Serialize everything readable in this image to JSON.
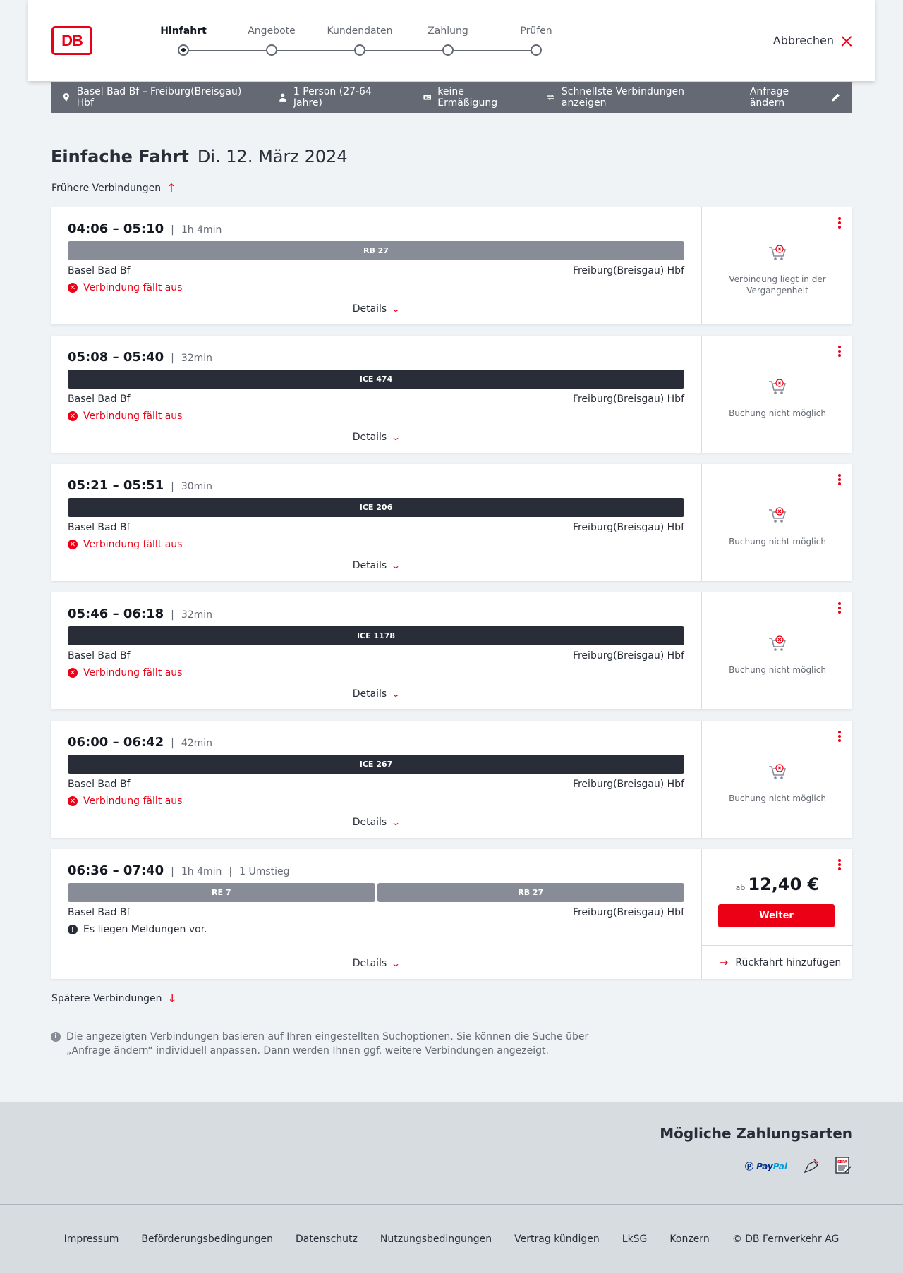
{
  "brand": {
    "logo_text": "DB",
    "accent": "#ec0016"
  },
  "steps": [
    {
      "label": "Hinfahrt",
      "active": true
    },
    {
      "label": "Angebote",
      "active": false
    },
    {
      "label": "Kundendaten",
      "active": false
    },
    {
      "label": "Zahlung",
      "active": false
    },
    {
      "label": "Prüfen",
      "active": false
    }
  ],
  "header": {
    "cancel_label": "Abbrechen"
  },
  "search": {
    "route": "Basel Bad Bf – Freiburg(Breisgau) Hbf",
    "travellers": "1 Person (27-64 Jahre)",
    "discount": "keine Ermäßigung",
    "fastest": "Schnellste Verbindungen anzeigen",
    "edit_label": "Anfrage ändern"
  },
  "page": {
    "title_bold": "Einfache Fahrt",
    "title_date": "Di. 12. März 2024",
    "earlier_label": "Frühere Verbindungen",
    "later_label": "Spätere Verbindungen",
    "details_label": "Details",
    "info_text": "Die angezeigten Verbindungen basieren auf Ihren eingestellten Suchoptionen. Sie können die Suche über „Anfrage ändern“ individuell anpassen. Dann werden Ihnen ggf. weitere Verbindungen angezeigt."
  },
  "connections": [
    {
      "times": "04:06 – 05:10",
      "duration": "1h 4min",
      "transfers": "",
      "trains": [
        {
          "name": "RB 27",
          "style": "grey"
        }
      ],
      "from": "Basel Bad Bf",
      "to": "Freiburg(Breisgau) Hbf",
      "status": "Verbindung fällt aus",
      "status_type": "cancelled",
      "side": "Verbindung liegt in der Vergangenheit"
    },
    {
      "times": "05:08 – 05:40",
      "duration": "32min",
      "transfers": "",
      "trains": [
        {
          "name": "ICE 474",
          "style": "dark"
        }
      ],
      "from": "Basel Bad Bf",
      "to": "Freiburg(Breisgau) Hbf",
      "status": "Verbindung fällt aus",
      "status_type": "cancelled",
      "side": "Buchung nicht möglich"
    },
    {
      "times": "05:21 – 05:51",
      "duration": "30min",
      "transfers": "",
      "trains": [
        {
          "name": "ICE 206",
          "style": "dark"
        }
      ],
      "from": "Basel Bad Bf",
      "to": "Freiburg(Breisgau) Hbf",
      "status": "Verbindung fällt aus",
      "status_type": "cancelled",
      "side": "Buchung nicht möglich"
    },
    {
      "times": "05:46 – 06:18",
      "duration": "32min",
      "transfers": "",
      "trains": [
        {
          "name": "ICE 1178",
          "style": "dark"
        }
      ],
      "from": "Basel Bad Bf",
      "to": "Freiburg(Breisgau) Hbf",
      "status": "Verbindung fällt aus",
      "status_type": "cancelled",
      "side": "Buchung nicht möglich"
    },
    {
      "times": "06:00 – 06:42",
      "duration": "42min",
      "transfers": "",
      "trains": [
        {
          "name": "ICE 267",
          "style": "dark"
        }
      ],
      "from": "Basel Bad Bf",
      "to": "Freiburg(Breisgau) Hbf",
      "status": "Verbindung fällt aus",
      "status_type": "cancelled",
      "side": "Buchung nicht möglich"
    },
    {
      "times": "06:36 – 07:40",
      "duration": "1h 4min",
      "transfers": "1 Umstieg",
      "trains": [
        {
          "name": "RE 7",
          "style": "grey"
        },
        {
          "name": "RB 27",
          "style": "grey"
        }
      ],
      "from": "Basel Bad Bf",
      "to": "Freiburg(Breisgau) Hbf",
      "status": "Es liegen Meldungen vor.",
      "status_type": "notice",
      "price_prefix": "ab",
      "price": "12,40 €",
      "button": "Weiter",
      "return_label": "Rückfahrt hinzufügen"
    }
  ],
  "payments": {
    "title": "Mögliche Zahlungsarten",
    "methods": [
      "PayPal",
      "credit-card-icon",
      "sepa-icon"
    ],
    "paypal_a": "Pay",
    "paypal_b": "Pal"
  },
  "footer": {
    "links": [
      "Impressum",
      "Beförderungsbedingungen",
      "Datenschutz",
      "Nutzungsbedingungen",
      "Vertrag kündigen",
      "LkSG",
      "Konzern",
      "© DB Fernverkehr AG"
    ]
  }
}
